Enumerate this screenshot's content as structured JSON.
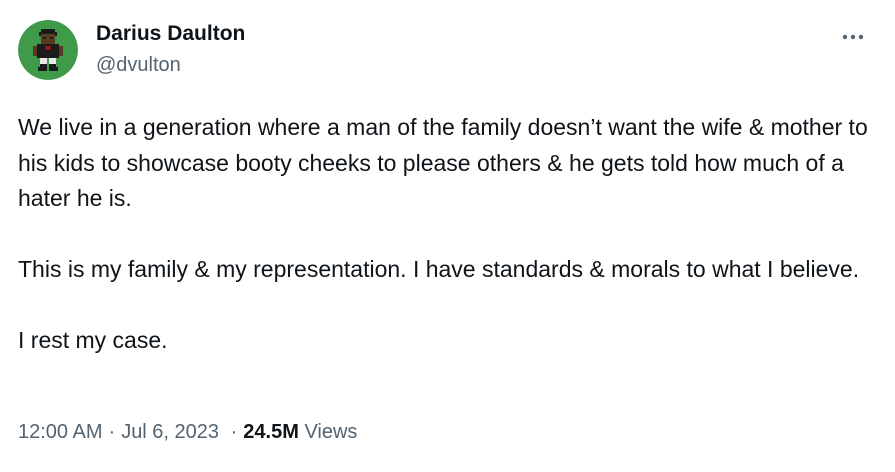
{
  "author": {
    "display_name": "Darius Daulton",
    "handle": "@dvulton",
    "avatar_icon": "pixel-art-person-avatar-icon",
    "avatar_bg": "#3f9a4a"
  },
  "more_icon": "more-horizontal-icon",
  "tweet": {
    "paragraphs": [
      "We live in a generation where a man of the family doesn’t want the wife & mother to his kids to showcase booty cheeks to please others & he gets told how much of a hater he is.",
      "This is my family & my representation. I have standards & morals to what I believe.",
      "I rest my case."
    ]
  },
  "meta": {
    "time": "12:00 AM",
    "date": "Jul 6, 2023",
    "separator": "·",
    "views_count": "24.5M",
    "views_label": "Views"
  },
  "colors": {
    "text_primary": "#0f1419",
    "text_secondary": "#536471"
  }
}
